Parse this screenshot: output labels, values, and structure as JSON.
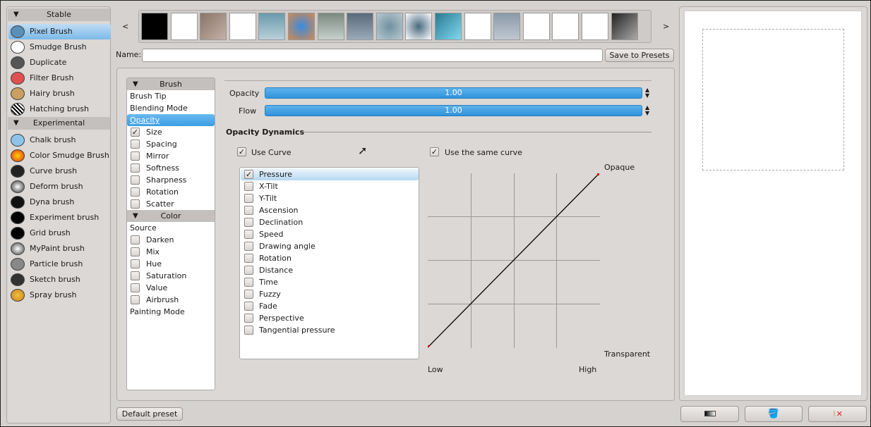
{
  "left_panel": {
    "groups": [
      {
        "title": "Stable",
        "items": [
          "Pixel Brush",
          "Smudge Brush",
          "Duplicate",
          "Filter Brush",
          "Hairy brush",
          "Hatching brush"
        ]
      },
      {
        "title": "Experimental",
        "items": [
          "Chalk brush",
          "Color Smudge Brush",
          "Curve brush",
          "Deform brush",
          "Dyna brush",
          "Experiment brush",
          "Grid brush",
          "MyPaint brush",
          "Particle brush",
          "Sketch brush",
          "Spray brush"
        ]
      }
    ],
    "selected": "Pixel Brush"
  },
  "presets": {
    "prev": "<",
    "next": ">",
    "count_visible": 17
  },
  "name_label": "Name:",
  "name_value": "",
  "save_button": "Save to Presets",
  "options": {
    "groups": [
      {
        "title": "Brush",
        "items": [
          {
            "label": "Brush Tip"
          },
          {
            "label": "Blending Mode"
          },
          {
            "label": "Opacity",
            "selected": true
          },
          {
            "label": "Size",
            "checked": true
          },
          {
            "label": "Spacing",
            "checked": false
          },
          {
            "label": "Mirror",
            "checked": false
          },
          {
            "label": "Softness",
            "checked": false
          },
          {
            "label": "Sharpness",
            "checked": false
          },
          {
            "label": "Rotation",
            "checked": false
          },
          {
            "label": "Scatter",
            "checked": false
          }
        ]
      },
      {
        "title": "Color",
        "items": [
          {
            "label": "Source"
          },
          {
            "label": "Darken",
            "checked": false
          },
          {
            "label": "Mix",
            "checked": false
          },
          {
            "label": "Hue",
            "checked": false
          },
          {
            "label": "Saturation",
            "checked": false
          },
          {
            "label": "Value",
            "checked": false
          },
          {
            "label": "Airbrush",
            "checked": false
          },
          {
            "label": "Painting Mode"
          }
        ]
      }
    ]
  },
  "opacity": {
    "label": "Opacity",
    "value": "1.00"
  },
  "flow": {
    "label": "Flow",
    "value": "1.00"
  },
  "dynamics": {
    "title": "Opacity Dynamics",
    "use_curve": "Use Curve",
    "use_same_curve": "Use the same curve",
    "sensors": [
      "Pressure",
      "X-Tilt",
      "Y-Tilt",
      "Ascension",
      "Declination",
      "Speed",
      "Drawing angle",
      "Rotation",
      "Distance",
      "Time",
      "Fuzzy",
      "Fade",
      "Perspective",
      "Tangential pressure"
    ],
    "checked_sensor": "Pressure",
    "curve": {
      "points": [
        [
          0,
          0
        ],
        [
          1,
          1
        ]
      ],
      "top_label": "Opaque",
      "bottom_label": "Transparent",
      "left_label": "Low",
      "right_label": "High"
    }
  },
  "default_preset": "Default preset",
  "accent": "#3a9ee4"
}
